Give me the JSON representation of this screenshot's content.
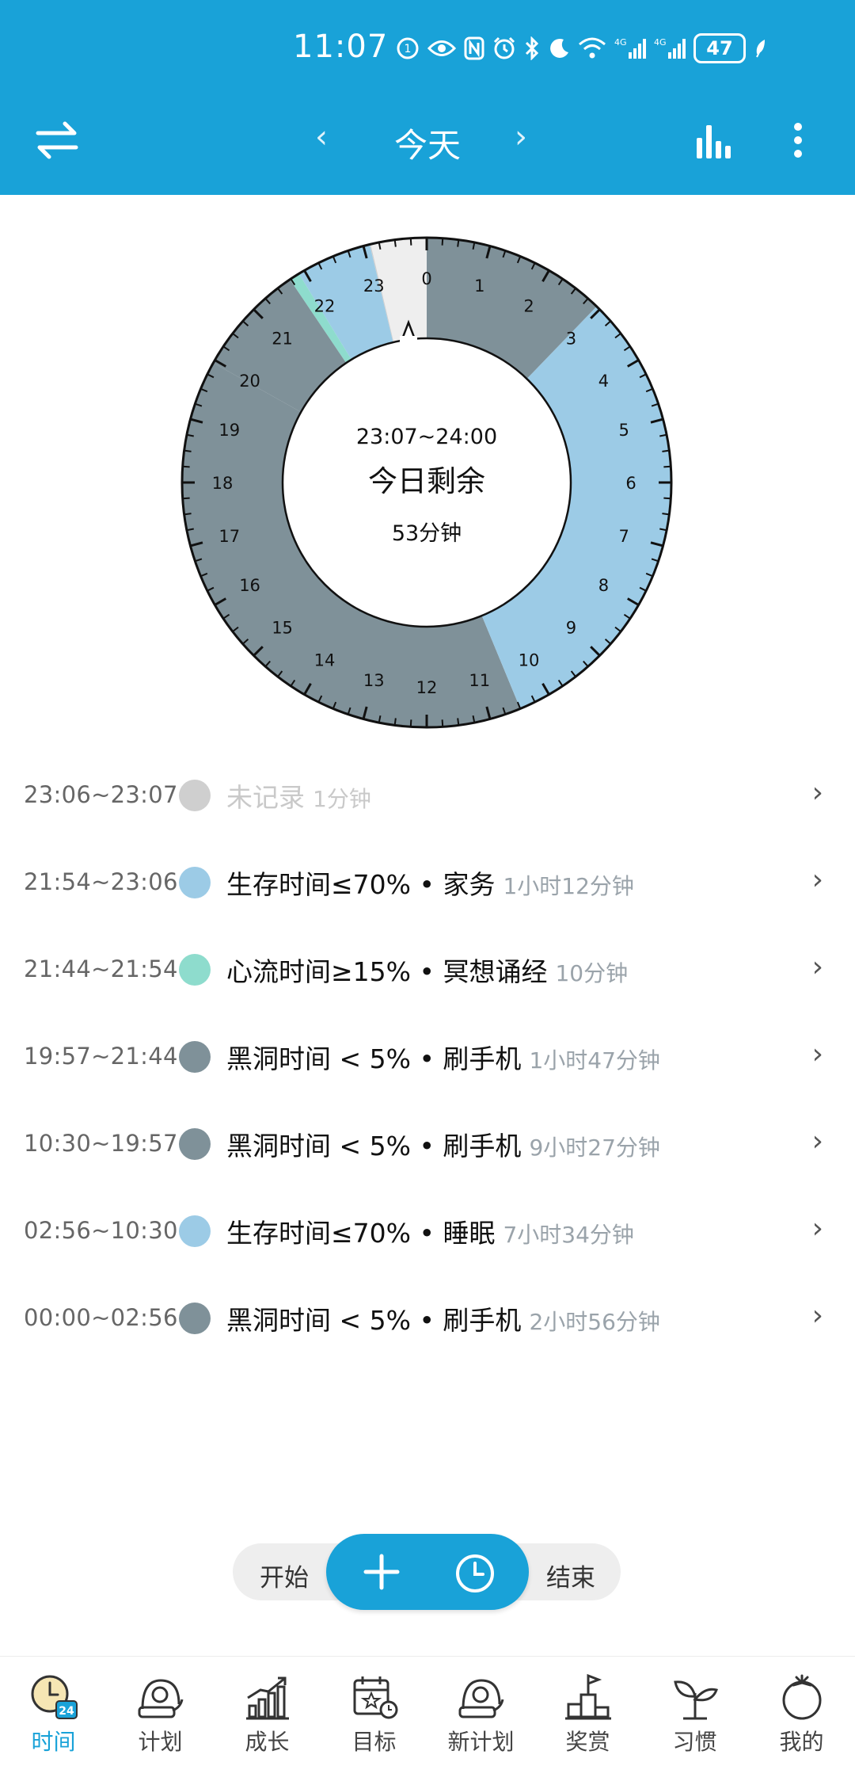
{
  "status_bar": {
    "time": "11:07",
    "icons": [
      "nfc-badge-icon",
      "eye-icon",
      "nfc-icon",
      "alarm-icon",
      "bluetooth-icon",
      "moon-icon",
      "wifi-icon",
      "signal-4g-icon",
      "signal-4g-icon"
    ],
    "battery": "47"
  },
  "header": {
    "title": "今天",
    "prev": "‹",
    "next": "›",
    "icons": [
      "swap-icon",
      "bar-chart-icon",
      "more-vertical-icon"
    ],
    "bg_color": "#19a2d8"
  },
  "clock": {
    "range": "23:07~24:00",
    "label": "今日剩余",
    "remaining": "53分钟",
    "hour_labels": [
      "0",
      "1",
      "2",
      "3",
      "4",
      "5",
      "6",
      "7",
      "8",
      "9",
      "10",
      "11",
      "12",
      "13",
      "14",
      "15",
      "16",
      "17",
      "18",
      "19",
      "20",
      "21",
      "22",
      "23"
    ]
  },
  "records": [
    {
      "time": "23:06~23:07",
      "name": "未记录",
      "duration": "1分钟",
      "color": "#cfcfcf",
      "unrecorded": true
    },
    {
      "time": "21:54~23:06",
      "name": "生存时间≤70% • 家务",
      "duration": "1小时12分钟",
      "color": "#9ccbe6"
    },
    {
      "time": "21:44~21:54",
      "name": "心流时间≥15% • 冥想诵经",
      "duration": "10分钟",
      "color": "#8edccd"
    },
    {
      "time": "19:57~21:44",
      "name": "黑洞时间 < 5% • 刷手机",
      "duration": "1小时47分钟",
      "color": "#7f9199"
    },
    {
      "time": "10:30~19:57",
      "name": "黑洞时间 < 5% • 刷手机",
      "duration": "9小时27分钟",
      "color": "#7f9199"
    },
    {
      "time": "02:56~10:30",
      "name": "生存时间≤70% • 睡眠",
      "duration": "7小时34分钟",
      "color": "#9ccbe6"
    },
    {
      "time": "00:00~02:56",
      "name": "黑洞时间 < 5% • 刷手机",
      "duration": "2小时56分钟",
      "color": "#7f9199"
    }
  ],
  "actions": {
    "start": "开始",
    "end": "结束",
    "add_icon": "plus-icon",
    "clock_icon": "clock-icon"
  },
  "bottom_nav": [
    {
      "label": "时间",
      "icon": "clock-24-icon",
      "active": true
    },
    {
      "label": "计划",
      "icon": "plan-icon"
    },
    {
      "label": "成长",
      "icon": "growth-chart-icon"
    },
    {
      "label": "目标",
      "icon": "target-calendar-icon"
    },
    {
      "label": "新计划",
      "icon": "new-plan-icon"
    },
    {
      "label": "奖赏",
      "icon": "podium-icon"
    },
    {
      "label": "习惯",
      "icon": "sprout-icon"
    },
    {
      "label": "我的",
      "icon": "tomato-icon"
    }
  ]
}
